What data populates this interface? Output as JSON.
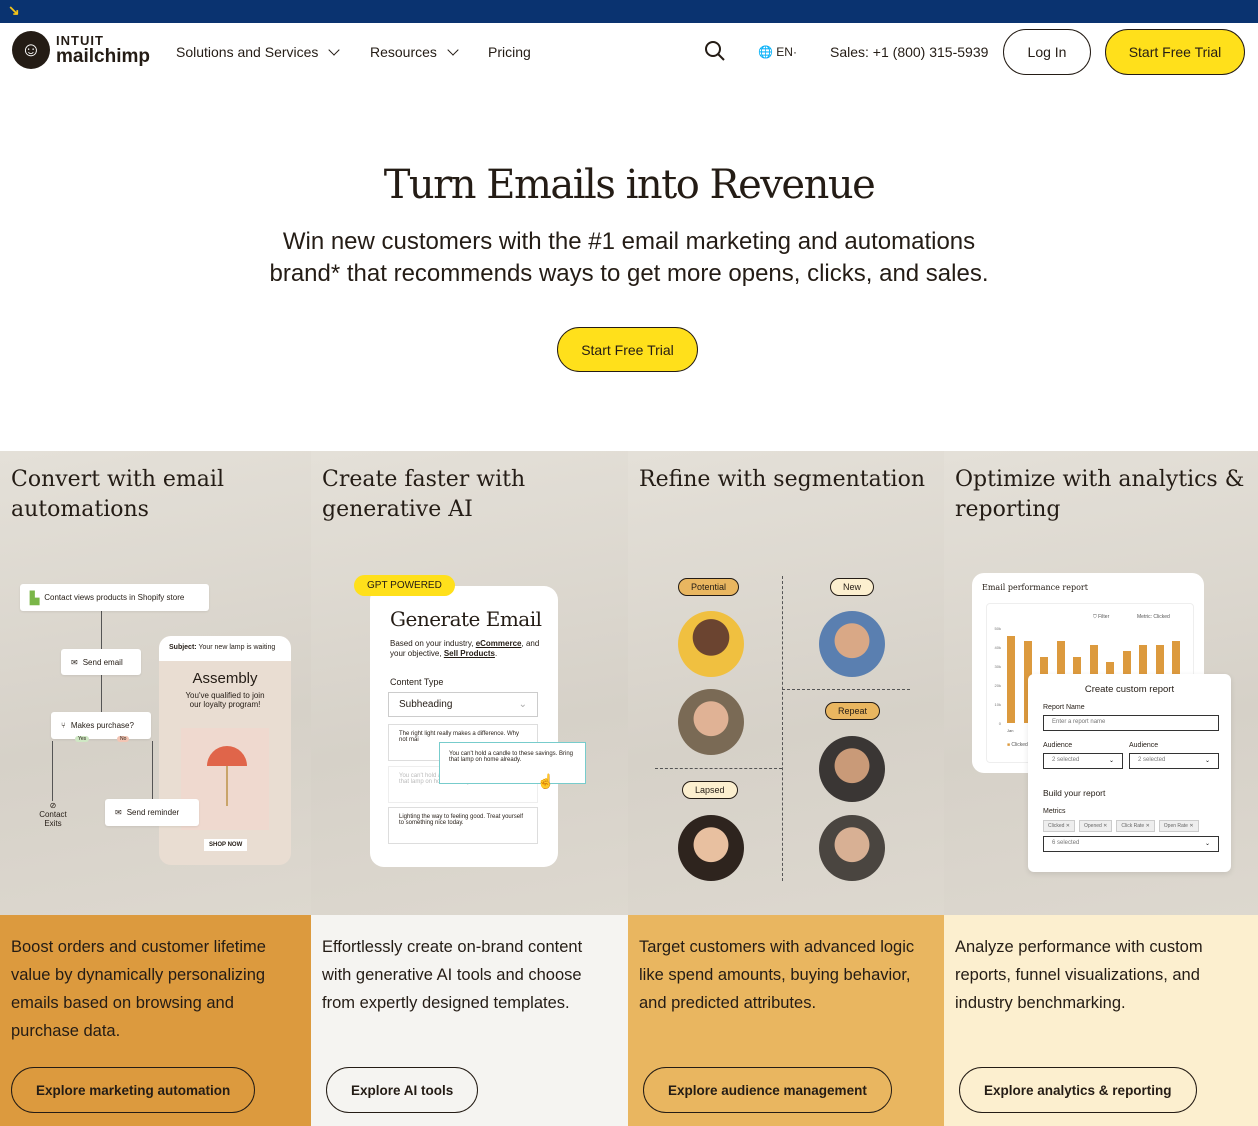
{
  "topbar": {
    "icon": "arrow-down-right-icon"
  },
  "nav": {
    "logo_top": "INTUIT",
    "logo_bottom": "mailchimp",
    "items": [
      "Solutions and Services",
      "Resources",
      "Pricing"
    ],
    "language": "EN",
    "sales": "Sales: +1 (800) 315-5939",
    "login": "Log In",
    "cta": "Start Free Trial"
  },
  "hero": {
    "title": "Turn Emails into Revenue",
    "subtitle_1": "Win new customers with the #1 email marketing and automations",
    "subtitle_2": "brand* that recommends ways to get more opens, clicks, and sales.",
    "cta": "Start Free Trial"
  },
  "features": [
    {
      "title": "Convert with email automations",
      "desc": "Boost orders and customer lifetime value by dynamically personalizing emails based on browsing and purchase data.",
      "button": "Explore marketing automation",
      "bg": "#dc9a3e"
    },
    {
      "title": "Create faster with generative AI",
      "desc": "Effortlessly create on-brand content with generative AI tools and choose from expertly designed templates.",
      "button": "Explore AI tools",
      "bg": "#f5f4f1"
    },
    {
      "title": "Refine with segmentation",
      "desc": "Target customers with advanced logic like spend amounts, buying behavior, and predicted attributes.",
      "button": "Explore audience management",
      "bg": "#e9b660"
    },
    {
      "title": "Optimize with analytics & reporting",
      "desc": "Analyze performance with custom reports, funnel visualizations, and industry benchmarking.",
      "button": "Explore analytics & reporting",
      "bg": "#fcefcf"
    }
  ],
  "automation": {
    "trigger": "Contact views products in Shopify store",
    "send_email": "Send email",
    "decision": "Makes purchase?",
    "yes": "Yes",
    "no": "No",
    "exit": "Contact Exits",
    "reminder": "Send reminder",
    "subject_label": "Subject:",
    "subject": "Your new lamp is waiting",
    "brand": "Assembly",
    "message": "You've qualified to join our loyalty program!",
    "shop": "SHOP NOW"
  },
  "ai": {
    "badge": "GPT POWERED",
    "title": "Generate Email",
    "desc_1": "Based on your industry, ",
    "industry": "eCommerce",
    "desc_2": ", and your objective, ",
    "objective": "Sell Products",
    "content_type": "Content Type",
    "select": "Subheading",
    "opt1": "The right light really makes a difference. Why not mai",
    "opt_popup": "You can't hold a candle to these savings. Bring that lamp on home already.",
    "opt2": "You can't hold a candle to these savings. Bring that lamp on home already.",
    "opt3": "Lighting the way to feeling good. Treat yourself to something nice today."
  },
  "segments": {
    "labels": [
      "Potential",
      "New",
      "Repeat",
      "Lapsed"
    ]
  },
  "analytics": {
    "report_title": "Email performance report",
    "filter": "Filter",
    "metric": "Metric: Clicked",
    "y_ticks": [
      "0",
      "10k",
      "20k",
      "30k",
      "40k",
      "50k"
    ],
    "bars": [
      46,
      43,
      35,
      43,
      35,
      41,
      32,
      38,
      41,
      41,
      43
    ],
    "bar_color": "#dc9a3e",
    "x_first": "Jan",
    "legend": "Clicked",
    "modal_title": "Create custom report",
    "report_name": "Report Name",
    "report_placeholder": "Enter a report name",
    "audience": "Audience",
    "audience_val": "2 selected",
    "build": "Build your report",
    "metrics": "Metrics",
    "chips": [
      "Clicked",
      "Opened",
      "Click Rate",
      "Open Rate"
    ],
    "metrics_val": "6 selected"
  }
}
